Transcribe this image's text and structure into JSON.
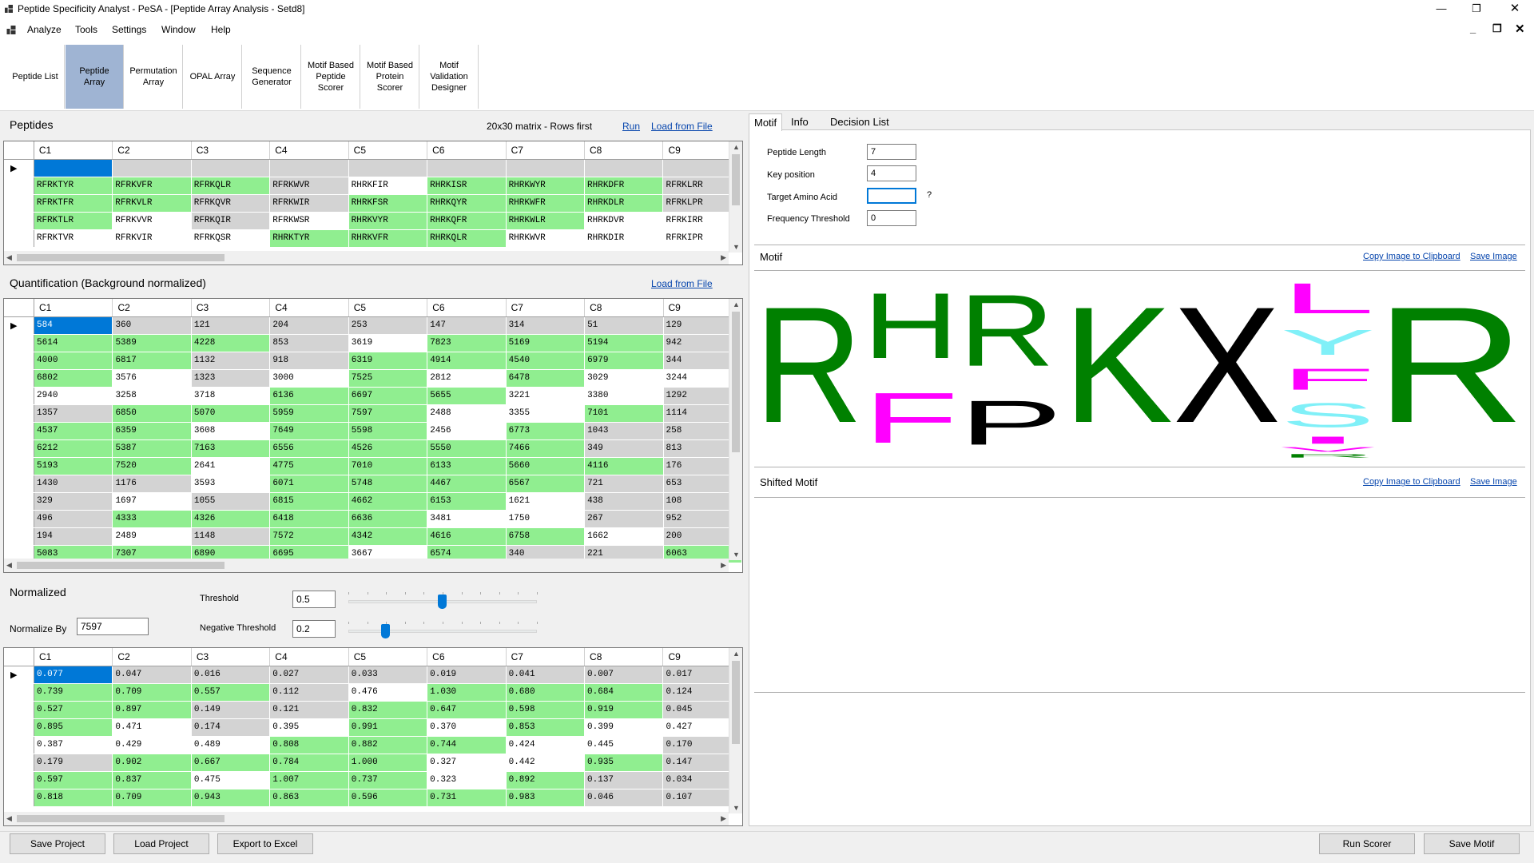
{
  "window": {
    "title": "Peptide Specificity Analyst - PeSA - [Peptide Array Analysis - Setd8]"
  },
  "menu": [
    "Analyze",
    "Tools",
    "Settings",
    "Window",
    "Help"
  ],
  "ribbon": [
    {
      "label": "Peptide List",
      "active": false
    },
    {
      "label": "Peptide Array",
      "active": true
    },
    {
      "label": "Permutation Array",
      "active": false
    },
    {
      "label": "OPAL Array",
      "active": false
    },
    {
      "label": "Sequence Generator",
      "active": false
    },
    {
      "label": "Motif Based Peptide Scorer",
      "active": false
    },
    {
      "label": "Motif Based Protein Scorer",
      "active": false
    },
    {
      "label": "Motif Validation Designer",
      "active": false
    }
  ],
  "peptides": {
    "title": "Peptides",
    "matrix_info": "20x30 matrix - Rows first",
    "run_label": "Run",
    "load_label": "Load from File",
    "columns": [
      "C1",
      "C2",
      "C3",
      "C4",
      "C5",
      "C6",
      "C7",
      "C8",
      "C9"
    ],
    "rows": [
      [
        [
          "",
          "sel"
        ],
        [
          "",
          "s"
        ],
        [
          "",
          "s"
        ],
        [
          "",
          "s"
        ],
        [
          "",
          "s"
        ],
        [
          "",
          "s"
        ],
        [
          "",
          "s"
        ],
        [
          "",
          "s"
        ],
        [
          "",
          "s"
        ]
      ],
      [
        [
          "RFRKTYR",
          "g"
        ],
        [
          "RFRKVFR",
          "g"
        ],
        [
          "RFRKQLR",
          "g"
        ],
        [
          "RFRKWVR",
          "s"
        ],
        [
          "RHRKFIR",
          "w"
        ],
        [
          "RHRKISR",
          "g"
        ],
        [
          "RHRKWYR",
          "g"
        ],
        [
          "RHRKDFR",
          "g"
        ],
        [
          "RFRKLRR",
          "s"
        ]
      ],
      [
        [
          "RFRKTFR",
          "g"
        ],
        [
          "RFRKVLR",
          "g"
        ],
        [
          "RFRKQVR",
          "s"
        ],
        [
          "RFRKWIR",
          "s"
        ],
        [
          "RHRKFSR",
          "g"
        ],
        [
          "RHRKQYR",
          "g"
        ],
        [
          "RHRKWFR",
          "g"
        ],
        [
          "RHRKDLR",
          "g"
        ],
        [
          "RFRKLPR",
          "s"
        ]
      ],
      [
        [
          "RFRKTLR",
          "g"
        ],
        [
          "RFRKVVR",
          "w"
        ],
        [
          "RFRKQIR",
          "s"
        ],
        [
          "RFRKWSR",
          "w"
        ],
        [
          "RHRKVYR",
          "g"
        ],
        [
          "RHRKQFR",
          "g"
        ],
        [
          "RHRKWLR",
          "g"
        ],
        [
          "RHRKDVR",
          "w"
        ],
        [
          "RFRKIRR",
          "w"
        ]
      ],
      [
        [
          "RFRKTVR",
          "w"
        ],
        [
          "RFRKVIR",
          "w"
        ],
        [
          "RFRKQSR",
          "w"
        ],
        [
          "RHRKTYR",
          "g"
        ],
        [
          "RHRKVFR",
          "g"
        ],
        [
          "RHRKQLR",
          "g"
        ],
        [
          "RHRKWVR",
          "w"
        ],
        [
          "RHRKDIR",
          "w"
        ],
        [
          "RFRKIPR",
          "w"
        ]
      ]
    ]
  },
  "quantification": {
    "title": "Quantification (Background normalized)",
    "load_label": "Load from File",
    "columns": [
      "C1",
      "C2",
      "C3",
      "C4",
      "C5",
      "C6",
      "C7",
      "C8",
      "C9"
    ],
    "rows": [
      [
        [
          "584",
          "sel"
        ],
        [
          "360",
          "s"
        ],
        [
          "121",
          "s"
        ],
        [
          "204",
          "s"
        ],
        [
          "253",
          "s"
        ],
        [
          "147",
          "s"
        ],
        [
          "314",
          "s"
        ],
        [
          "51",
          "s"
        ],
        [
          "129",
          "s"
        ]
      ],
      [
        [
          "5614",
          "g"
        ],
        [
          "5389",
          "g"
        ],
        [
          "4228",
          "g"
        ],
        [
          "853",
          "s"
        ],
        [
          "3619",
          "w"
        ],
        [
          "7823",
          "g"
        ],
        [
          "5169",
          "g"
        ],
        [
          "5194",
          "g"
        ],
        [
          "942",
          "s"
        ]
      ],
      [
        [
          "4000",
          "g"
        ],
        [
          "6817",
          "g"
        ],
        [
          "1132",
          "s"
        ],
        [
          "918",
          "s"
        ],
        [
          "6319",
          "g"
        ],
        [
          "4914",
          "g"
        ],
        [
          "4540",
          "g"
        ],
        [
          "6979",
          "g"
        ],
        [
          "344",
          "s"
        ]
      ],
      [
        [
          "6802",
          "g"
        ],
        [
          "3576",
          "w"
        ],
        [
          "1323",
          "s"
        ],
        [
          "3000",
          "w"
        ],
        [
          "7525",
          "g"
        ],
        [
          "2812",
          "w"
        ],
        [
          "6478",
          "g"
        ],
        [
          "3029",
          "w"
        ],
        [
          "3244",
          "w"
        ]
      ],
      [
        [
          "2940",
          "w"
        ],
        [
          "3258",
          "w"
        ],
        [
          "3718",
          "w"
        ],
        [
          "6136",
          "g"
        ],
        [
          "6697",
          "g"
        ],
        [
          "5655",
          "g"
        ],
        [
          "3221",
          "w"
        ],
        [
          "3380",
          "w"
        ],
        [
          "1292",
          "s"
        ]
      ],
      [
        [
          "1357",
          "s"
        ],
        [
          "6850",
          "g"
        ],
        [
          "5070",
          "g"
        ],
        [
          "5959",
          "g"
        ],
        [
          "7597",
          "g"
        ],
        [
          "2488",
          "w"
        ],
        [
          "3355",
          "w"
        ],
        [
          "7101",
          "g"
        ],
        [
          "1114",
          "s"
        ]
      ],
      [
        [
          "4537",
          "g"
        ],
        [
          "6359",
          "g"
        ],
        [
          "3608",
          "w"
        ],
        [
          "7649",
          "g"
        ],
        [
          "5598",
          "g"
        ],
        [
          "2456",
          "w"
        ],
        [
          "6773",
          "g"
        ],
        [
          "1043",
          "s"
        ],
        [
          "258",
          "s"
        ]
      ],
      [
        [
          "6212",
          "g"
        ],
        [
          "5387",
          "g"
        ],
        [
          "7163",
          "g"
        ],
        [
          "6556",
          "g"
        ],
        [
          "4526",
          "g"
        ],
        [
          "5550",
          "g"
        ],
        [
          "7466",
          "g"
        ],
        [
          "349",
          "s"
        ],
        [
          "813",
          "s"
        ]
      ],
      [
        [
          "5193",
          "g"
        ],
        [
          "7520",
          "g"
        ],
        [
          "2641",
          "w"
        ],
        [
          "4775",
          "g"
        ],
        [
          "7010",
          "g"
        ],
        [
          "6133",
          "g"
        ],
        [
          "5660",
          "g"
        ],
        [
          "4116",
          "g"
        ],
        [
          "176",
          "s"
        ]
      ],
      [
        [
          "1430",
          "s"
        ],
        [
          "1176",
          "s"
        ],
        [
          "3593",
          "w"
        ],
        [
          "6071",
          "g"
        ],
        [
          "5748",
          "g"
        ],
        [
          "4467",
          "g"
        ],
        [
          "6567",
          "g"
        ],
        [
          "721",
          "s"
        ],
        [
          "653",
          "s"
        ]
      ],
      [
        [
          "329",
          "s"
        ],
        [
          "1697",
          "w"
        ],
        [
          "1055",
          "s"
        ],
        [
          "6815",
          "g"
        ],
        [
          "4662",
          "g"
        ],
        [
          "6153",
          "g"
        ],
        [
          "1621",
          "w"
        ],
        [
          "438",
          "s"
        ],
        [
          "108",
          "s"
        ]
      ],
      [
        [
          "496",
          "s"
        ],
        [
          "4333",
          "g"
        ],
        [
          "4326",
          "g"
        ],
        [
          "6418",
          "g"
        ],
        [
          "6636",
          "g"
        ],
        [
          "3481",
          "w"
        ],
        [
          "1750",
          "w"
        ],
        [
          "267",
          "s"
        ],
        [
          "952",
          "s"
        ]
      ],
      [
        [
          "194",
          "s"
        ],
        [
          "2489",
          "w"
        ],
        [
          "1148",
          "s"
        ],
        [
          "7572",
          "g"
        ],
        [
          "4342",
          "g"
        ],
        [
          "4616",
          "g"
        ],
        [
          "6758",
          "g"
        ],
        [
          "1662",
          "w"
        ],
        [
          "200",
          "s"
        ]
      ],
      [
        [
          "5083",
          "g"
        ],
        [
          "7307",
          "g"
        ],
        [
          "6890",
          "g"
        ],
        [
          "6695",
          "g"
        ],
        [
          "3667",
          "w"
        ],
        [
          "6574",
          "g"
        ],
        [
          "340",
          "s"
        ],
        [
          "221",
          "s"
        ],
        [
          "6063",
          "g"
        ]
      ]
    ]
  },
  "normalized": {
    "title": "Normalized",
    "threshold_label": "Threshold",
    "threshold_value": "0.5",
    "threshold_fraction": 0.5,
    "neg_threshold_label": "Negative Threshold",
    "neg_threshold_value": "0.2",
    "neg_threshold_fraction": 0.2,
    "normalize_by_label": "Normalize By",
    "normalize_by_value": "7597",
    "columns": [
      "C1",
      "C2",
      "C3",
      "C4",
      "C5",
      "C6",
      "C7",
      "C8",
      "C9"
    ],
    "rows": [
      [
        [
          "0.077",
          "sel"
        ],
        [
          "0.047",
          "s"
        ],
        [
          "0.016",
          "s"
        ],
        [
          "0.027",
          "s"
        ],
        [
          "0.033",
          "s"
        ],
        [
          "0.019",
          "s"
        ],
        [
          "0.041",
          "s"
        ],
        [
          "0.007",
          "s"
        ],
        [
          "0.017",
          "s"
        ]
      ],
      [
        [
          "0.739",
          "g"
        ],
        [
          "0.709",
          "g"
        ],
        [
          "0.557",
          "g"
        ],
        [
          "0.112",
          "s"
        ],
        [
          "0.476",
          "w"
        ],
        [
          "1.030",
          "g"
        ],
        [
          "0.680",
          "g"
        ],
        [
          "0.684",
          "g"
        ],
        [
          "0.124",
          "s"
        ]
      ],
      [
        [
          "0.527",
          "g"
        ],
        [
          "0.897",
          "g"
        ],
        [
          "0.149",
          "s"
        ],
        [
          "0.121",
          "s"
        ],
        [
          "0.832",
          "g"
        ],
        [
          "0.647",
          "g"
        ],
        [
          "0.598",
          "g"
        ],
        [
          "0.919",
          "g"
        ],
        [
          "0.045",
          "s"
        ]
      ],
      [
        [
          "0.895",
          "g"
        ],
        [
          "0.471",
          "w"
        ],
        [
          "0.174",
          "s"
        ],
        [
          "0.395",
          "w"
        ],
        [
          "0.991",
          "g"
        ],
        [
          "0.370",
          "w"
        ],
        [
          "0.853",
          "g"
        ],
        [
          "0.399",
          "w"
        ],
        [
          "0.427",
          "w"
        ]
      ],
      [
        [
          "0.387",
          "w"
        ],
        [
          "0.429",
          "w"
        ],
        [
          "0.489",
          "w"
        ],
        [
          "0.808",
          "g"
        ],
        [
          "0.882",
          "g"
        ],
        [
          "0.744",
          "g"
        ],
        [
          "0.424",
          "w"
        ],
        [
          "0.445",
          "w"
        ],
        [
          "0.170",
          "s"
        ]
      ],
      [
        [
          "0.179",
          "s"
        ],
        [
          "0.902",
          "g"
        ],
        [
          "0.667",
          "g"
        ],
        [
          "0.784",
          "g"
        ],
        [
          "1.000",
          "g"
        ],
        [
          "0.327",
          "w"
        ],
        [
          "0.442",
          "w"
        ],
        [
          "0.935",
          "g"
        ],
        [
          "0.147",
          "s"
        ]
      ],
      [
        [
          "0.597",
          "g"
        ],
        [
          "0.837",
          "g"
        ],
        [
          "0.475",
          "w"
        ],
        [
          "1.007",
          "g"
        ],
        [
          "0.737",
          "g"
        ],
        [
          "0.323",
          "w"
        ],
        [
          "0.892",
          "g"
        ],
        [
          "0.137",
          "s"
        ],
        [
          "0.034",
          "s"
        ]
      ],
      [
        [
          "0.818",
          "g"
        ],
        [
          "0.709",
          "g"
        ],
        [
          "0.943",
          "g"
        ],
        [
          "0.863",
          "g"
        ],
        [
          "0.596",
          "g"
        ],
        [
          "0.731",
          "g"
        ],
        [
          "0.983",
          "g"
        ],
        [
          "0.046",
          "s"
        ],
        [
          "0.107",
          "s"
        ]
      ]
    ]
  },
  "bottom_left_buttons": [
    "Save Project",
    "Load Project",
    "Export to Excel"
  ],
  "bottom_right_buttons": [
    "Run Scorer",
    "Save Motif"
  ],
  "right_tabs": [
    "Motif",
    "Info",
    "Decision List"
  ],
  "params": [
    {
      "label": "Peptide Length",
      "value": "7"
    },
    {
      "label": "Key position",
      "value": "4"
    },
    {
      "label": "Target Amino Acid",
      "value": ""
    },
    {
      "label": "Frequency Threshold",
      "value": "0"
    }
  ],
  "help_mark": "?",
  "motif_section": {
    "title": "Motif",
    "copy_label": "Copy Image to Clipboard",
    "save_label": "Save Image"
  },
  "shifted_section": {
    "title": "Shifted Motif",
    "copy_label": "Copy Image to Clipboard",
    "save_label": "Save Image"
  },
  "logo": {
    "colors": {
      "green": "#008000",
      "magenta": "#ff00ff",
      "cyan": "#80f0f8",
      "black": "#000000"
    },
    "letters": [
      "R",
      "H",
      "F",
      "R",
      "P",
      "K",
      "X",
      "L",
      "Y",
      "F",
      "S",
      "I",
      "V",
      "R",
      "R"
    ]
  }
}
